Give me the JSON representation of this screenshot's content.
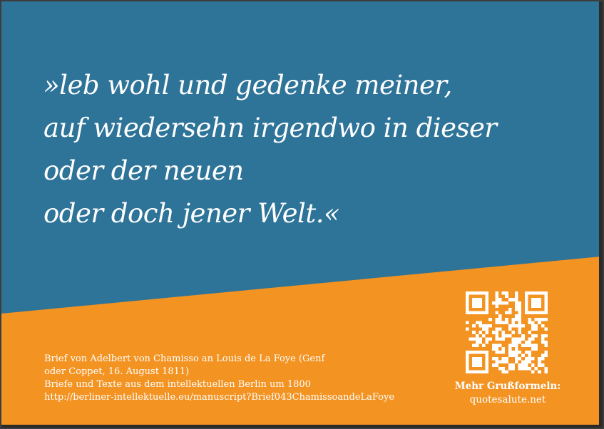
{
  "quote": {
    "lines": [
      "»leb wohl und gedenke meiner,",
      "auf wiedersehn irgendwo in dieser",
      "oder der neuen",
      "oder doch jener Welt.«"
    ]
  },
  "source": {
    "lines": [
      "Brief von Adelbert von Chamisso an Louis de La Foye (Genf",
      "oder Coppet, 16. August 1811)",
      "Briefe und Texte aus dem intellektuellen Berlin um 1800",
      "http://berliner-intellektuelle.eu/manuscript?Brief043ChamissoandeLaFoye"
    ]
  },
  "more": {
    "title": "Mehr Grußformeln:",
    "link": "quotesalute.net"
  },
  "colors": {
    "blue": "#2e7398",
    "orange": "#f39322",
    "text": "#ffffff"
  },
  "icons": {
    "qr": "qr-code-icon"
  }
}
